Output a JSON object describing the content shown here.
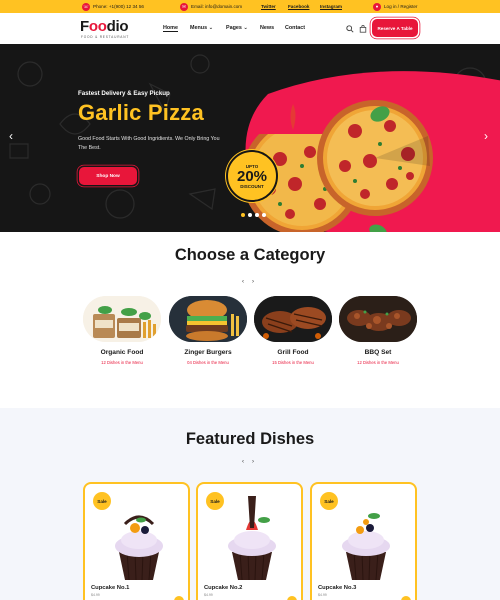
{
  "topbar": {
    "phone": "Phone: +1(900) 12 34 56",
    "email": "Email: info@domain.com",
    "links": [
      "Twitter",
      "Facebook",
      "Instagram"
    ],
    "login": "Log in / Register"
  },
  "header": {
    "logo_pre": "F",
    "logo_oo": "oo",
    "logo_post": "dio",
    "logo_sub": "FOOD & RESTAURANT",
    "nav": [
      "Home",
      "Menus",
      "Pages",
      "News",
      "Contact"
    ],
    "reserve_label": "Reserve A Table"
  },
  "hero": {
    "tagline": "Fastest Delivery & Easy Pickup",
    "title": "Garlic Pizza",
    "description": "Good Food Starts With Good Ingridients. We Only Bring You The Best.",
    "button_label": "Shop Now",
    "badge": {
      "top": "UPTO",
      "value": "20%",
      "bottom": "DISCOUNT"
    },
    "slide_count": 4,
    "active_slide": 1
  },
  "categories": {
    "title": "Choose a Category",
    "items": [
      {
        "name": "Organic Food",
        "count": "12 Dishes in the Menu"
      },
      {
        "name": "Zinger Burgers",
        "count": "04 Dishes in the Menu"
      },
      {
        "name": "Grill Food",
        "count": "15 Dishes in the Menu"
      },
      {
        "name": "BBQ Set",
        "count": "12 Dishes in the Menu"
      }
    ]
  },
  "featured": {
    "title": "Featured Dishes",
    "items": [
      {
        "sale": "Sale",
        "name": "Cupcake No.1",
        "price": "$4.99"
      },
      {
        "sale": "Sale",
        "name": "Cupcake No.2",
        "price": "$4.99"
      },
      {
        "sale": "Sale",
        "name": "Cupcake No.3",
        "price": "$4.99"
      }
    ]
  },
  "colors": {
    "brand_red": "#e8163a",
    "brand_yellow": "#ffc222",
    "hero_bg": "#161616"
  }
}
